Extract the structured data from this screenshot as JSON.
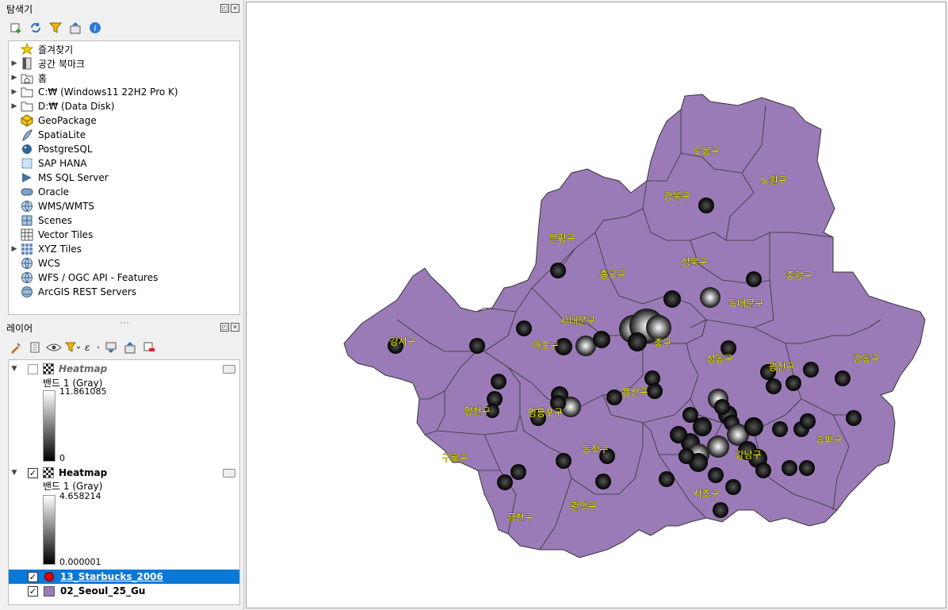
{
  "browser_panel": {
    "title": "탐색기",
    "toolbar_icons": [
      "add-layer-icon",
      "refresh-icon",
      "filter-icon",
      "collapse-all-icon",
      "info-icon"
    ],
    "items": [
      {
        "label": "즐겨찾기",
        "icon": "star-icon",
        "expandable": false
      },
      {
        "label": "공간 북마크",
        "icon": "bookmark-icon",
        "expandable": true
      },
      {
        "label": "홈",
        "icon": "home-folder-icon",
        "expandable": true
      },
      {
        "label": "C:₩ (Windows11 22H2 Pro K)",
        "icon": "folder-icon",
        "expandable": true
      },
      {
        "label": "D:₩ (Data Disk)",
        "icon": "folder-icon",
        "expandable": true
      },
      {
        "label": "GeoPackage",
        "icon": "geopackage-icon",
        "expandable": false
      },
      {
        "label": "SpatiaLite",
        "icon": "spatialite-icon",
        "expandable": false
      },
      {
        "label": "PostgreSQL",
        "icon": "postgresql-icon",
        "expandable": false
      },
      {
        "label": "SAP HANA",
        "icon": "sap-hana-icon",
        "expandable": false
      },
      {
        "label": "MS SQL Server",
        "icon": "mssql-icon",
        "expandable": false
      },
      {
        "label": "Oracle",
        "icon": "oracle-icon",
        "expandable": false
      },
      {
        "label": "WMS/WMTS",
        "icon": "globe-icon",
        "expandable": false
      },
      {
        "label": "Scenes",
        "icon": "scenes-icon",
        "expandable": false
      },
      {
        "label": "Vector Tiles",
        "icon": "vector-tiles-icon",
        "expandable": false
      },
      {
        "label": "XYZ Tiles",
        "icon": "xyz-tiles-icon",
        "expandable": true
      },
      {
        "label": "WCS",
        "icon": "globe-icon",
        "expandable": false
      },
      {
        "label": "WFS / OGC API - Features",
        "icon": "globe-icon",
        "expandable": false
      },
      {
        "label": "ArcGIS REST Servers",
        "icon": "arcgis-icon",
        "expandable": false
      }
    ]
  },
  "layers_panel": {
    "title": "레이어",
    "toolbar_icons": [
      "style-icon",
      "add-group-icon",
      "eye-icon",
      "filter-icon",
      "expression-filter-icon",
      "expand-all-icon",
      "collapse-all-icon",
      "remove-layer-icon"
    ],
    "heatmap1": {
      "name": "Heatmap",
      "checked": false,
      "band": "밴드 1 (Gray)",
      "max": "11.861085",
      "min": "0"
    },
    "heatmap2": {
      "name": "Heatmap",
      "checked": true,
      "band": "밴드 1 (Gray)",
      "max": "4.658214",
      "min": "0.000001"
    },
    "starbucks": {
      "name": "13_Starbucks_2006",
      "checked": true,
      "color": "#e00000"
    },
    "gu": {
      "name": "02_Seoul_25_Gu",
      "checked": true,
      "color": "#9a7bb7"
    }
  },
  "map": {
    "fill_color": "#9a7bb7",
    "label_color": "#ffff00",
    "district_labels": [
      "도봉구",
      "노원구",
      "강북구",
      "은평구",
      "성북구",
      "종로구",
      "중랑구",
      "동대문구",
      "서대문구",
      "강서구",
      "마포구",
      "중구",
      "성동구",
      "광진구",
      "강동구",
      "양천구",
      "영등포구",
      "용산구",
      "송파구",
      "구로구",
      "동작구",
      "강남구",
      "서초구",
      "관악구",
      "금천구"
    ]
  }
}
